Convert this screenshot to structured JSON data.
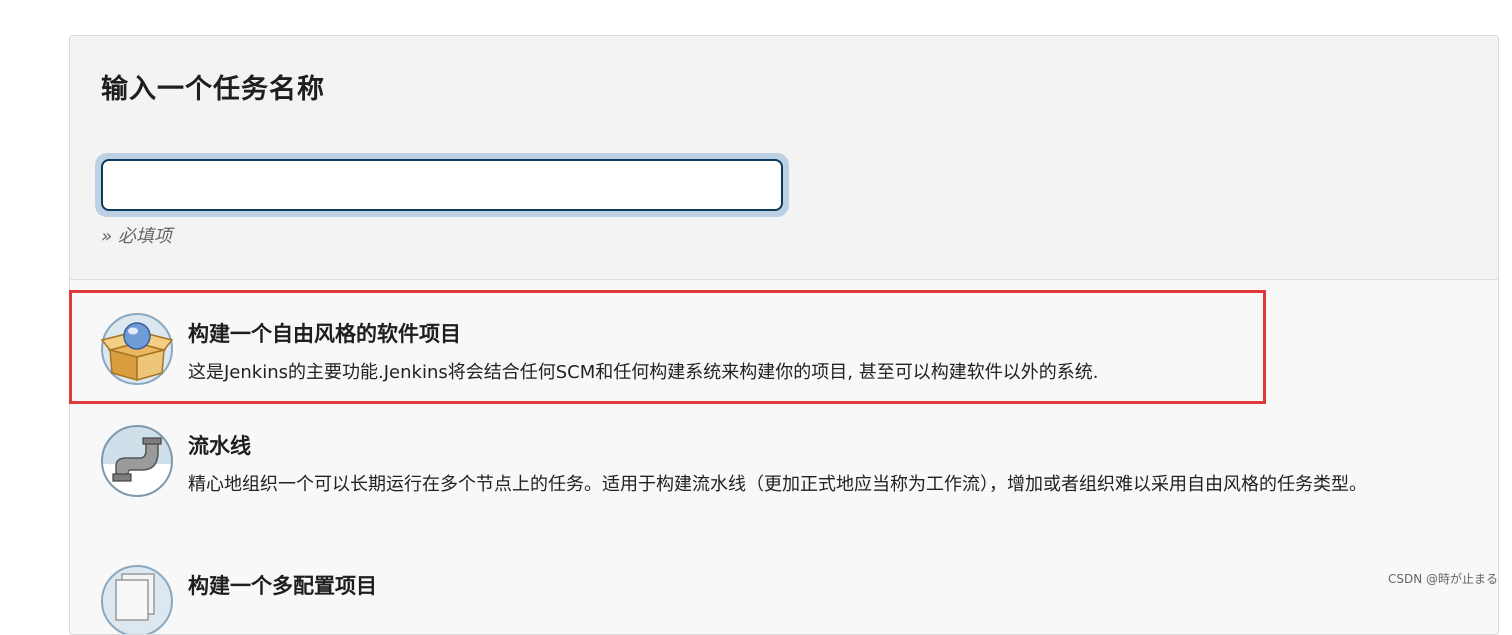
{
  "form": {
    "title": "输入一个任务名称",
    "name_value": "",
    "required_hint": "» 必填项"
  },
  "items": [
    {
      "name": "构建一个自由风格的软件项目",
      "description": "这是Jenkins的主要功能.Jenkins将会结合任何SCM和任何构建系统来构建你的项目, 甚至可以构建软件以外的系统.",
      "icon": "freestyle-box-icon",
      "highlighted": true
    },
    {
      "name": "流水线",
      "description": "精心地组织一个可以长期运行在多个节点上的任务。适用于构建流水线（更加正式地应当称为工作流），增加或者组织难以采用自由风格的任务类型。",
      "icon": "pipeline-pipe-icon"
    },
    {
      "name": "构建一个多配置项目",
      "description": "",
      "icon": "multi-config-icon"
    }
  ],
  "watermark": "CSDN @時が止まる",
  "colors": {
    "input_border": "#0b3a5b",
    "input_halo": "#bcd1e4",
    "highlight_border": "#e0393c"
  }
}
